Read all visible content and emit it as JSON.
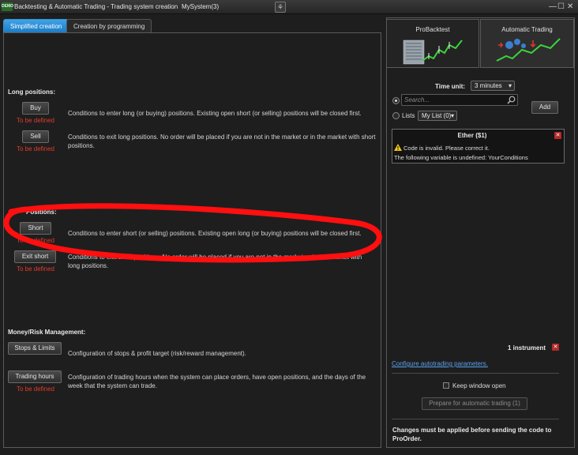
{
  "window": {
    "logo": "DEMO",
    "title": "Backtesting & Automatic Trading - Trading system creation",
    "system_name": "MySystem(3)",
    "controls": [
      "—",
      "☐",
      "✕"
    ]
  },
  "tabs": {
    "simplified": "Simplified creation",
    "programming": "Creation by programming"
  },
  "long": {
    "heading": "Long positions:",
    "buy_label": "Buy",
    "buy_status": "To be defined",
    "buy_desc": "Conditions to enter long (or buying) positions. Existing open short (or selling) positions will be closed first.",
    "sell_label": "Sell",
    "sell_status": "To be defined",
    "sell_desc": "Conditions to exit long positions.  No order will be placed if you are not in the market or in the market with short positions."
  },
  "short": {
    "heading": "Positions:",
    "short_label": "Short",
    "short_status": "To be defined",
    "short_desc": "Conditions to enter short (or selling) positions. Existing open long (or buying) positions will be closed first.",
    "exit_label": "Exit short",
    "exit_status": "To be defined",
    "exit_desc_1": "Conditions to exit short positions.  No order will be placed if you are not in the market or in the market with",
    "exit_desc_2": "long positions."
  },
  "risk": {
    "heading": "Money/Risk Management:",
    "stops_label": "Stops & Limits",
    "stops_desc": "Configuration of stops & profit target (risk/reward management).",
    "hours_label": "Trading hours",
    "hours_status": "To be defined",
    "hours_desc": "Configuration of trading hours when the system can place orders, have open positions, and the days of the week that the system can trade."
  },
  "right": {
    "probacktest_tab": "ProBacktest",
    "autotrading_tab": "Automatic Trading",
    "time_unit_label": "Time unit:",
    "time_unit_value": "3 minutes",
    "search_placeholder": "Search...",
    "add_label": "Add",
    "lists_label": "Lists",
    "list_value": "My List (0)",
    "instrument_name": "Ether ($1)",
    "error_1": "Code is invalid. Please correct it.",
    "error_2": "The following variable is undefined: YourConditions",
    "instrument_count": "1 instrument",
    "config_link": "Configure autotrading parameters.",
    "keep_open_label": "Keep window open",
    "prepare_label": "Prepare for automatic trading (1)",
    "footer_note": "Changes must be applied before sending the code to ProOrder."
  },
  "annotation": {
    "color": "#ff0f0f"
  },
  "colors": {
    "accent": "#1d7cc4",
    "to_be_defined": "#e03a2a",
    "link": "#5aa0ee",
    "close_box": "#b32a2a"
  }
}
